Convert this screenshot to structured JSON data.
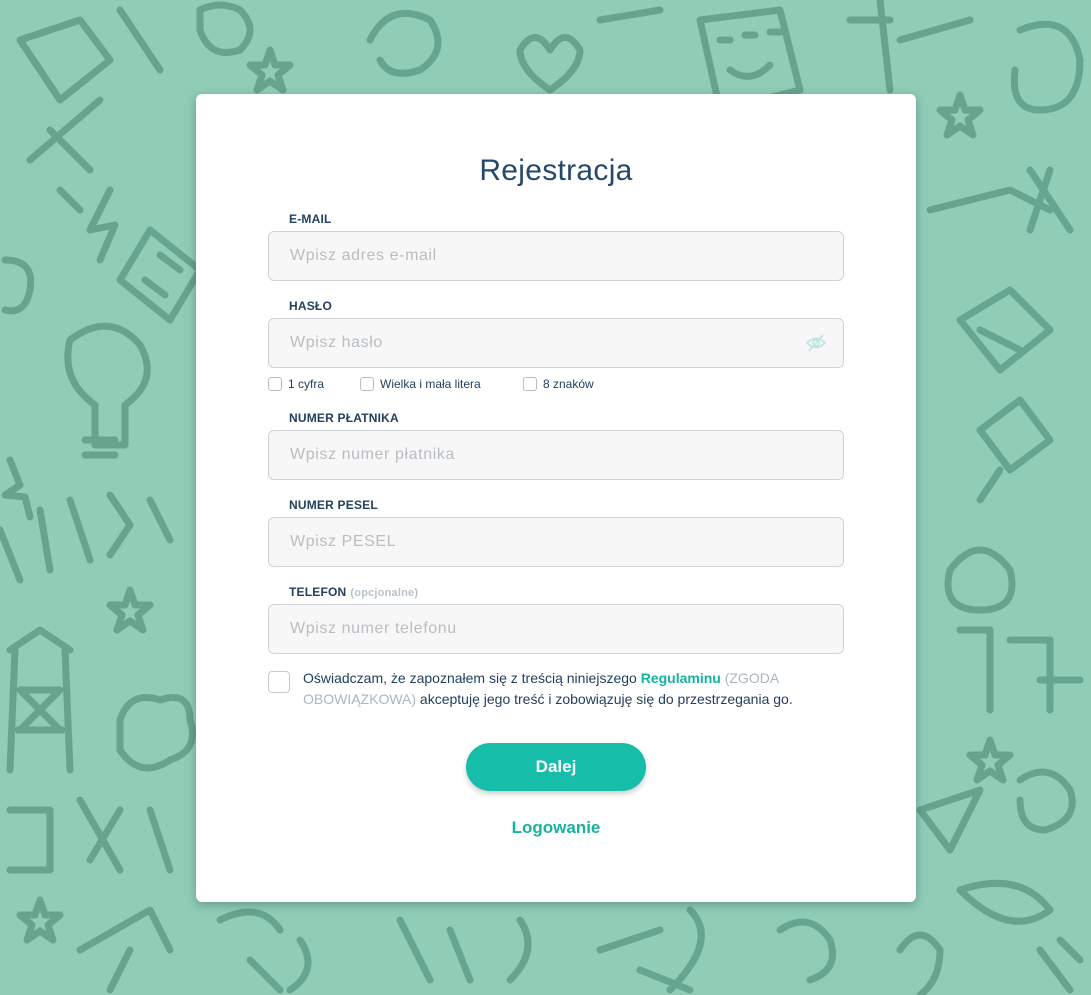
{
  "form": {
    "title": "Rejestracja",
    "email": {
      "label": "E-MAIL",
      "placeholder": "Wpisz adres e-mail",
      "value": ""
    },
    "password": {
      "label": "HASŁO",
      "placeholder": "Wpisz hasło",
      "value": "",
      "toggle_icon": "eye-off-icon"
    },
    "password_rules": [
      "1 cyfra",
      "Wielka i mała litera",
      "8 znaków"
    ],
    "payer": {
      "label": "NUMER PŁATNIKA",
      "placeholder": "Wpisz numer płatnika",
      "value": ""
    },
    "pesel": {
      "label": "NUMER PESEL",
      "placeholder": "Wpisz PESEL",
      "value": ""
    },
    "phone": {
      "label": "TELEFON",
      "optional_note": "(opcjonalne)",
      "placeholder": "Wpisz numer telefonu",
      "value": ""
    },
    "consent": {
      "text_before": "Oświadczam, że zapoznałem się z treścią niniejszego ",
      "link": "Regulaminu",
      "required_note": " (ZGODA OBOWIĄZKOWA)",
      "text_after": " akceptuję jego treść i zobowiązuję się do przestrzegania go.",
      "checked": false
    },
    "submit_label": "Dalej",
    "login_link": "Logowanie"
  },
  "colors": {
    "background": "#8fcdb7",
    "doodle": "#5f9e88",
    "heading": "#27486b",
    "accent": "#16bda9",
    "muted": "#b9bec3"
  }
}
